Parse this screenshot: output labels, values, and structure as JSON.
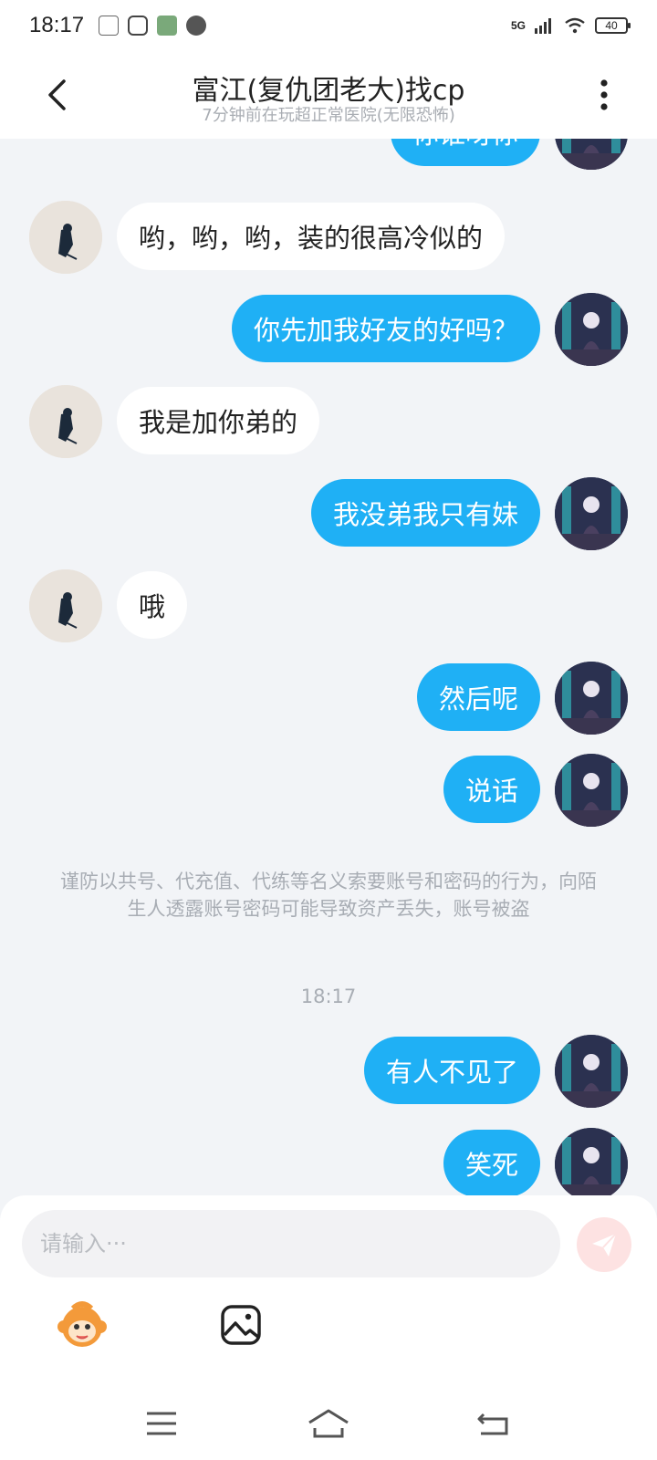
{
  "status_bar": {
    "time": "18:17",
    "network": "5G",
    "battery": "40"
  },
  "header": {
    "title": "富江(复仇团老大)找cp",
    "subtitle": "7分钟前在玩超正常医院(无限恐怖)"
  },
  "messages": [
    {
      "side": "out",
      "text": "你谁呀你"
    },
    {
      "side": "in",
      "text": "哟，哟，哟，装的很高冷似的"
    },
    {
      "side": "out",
      "text": "你先加我好友的好吗？"
    },
    {
      "side": "in",
      "text": "我是加你弟的"
    },
    {
      "side": "out",
      "text": "我没弟我只有妹"
    },
    {
      "side": "in",
      "text": "哦"
    },
    {
      "side": "out",
      "text": "然后呢"
    },
    {
      "side": "out",
      "text": "说话"
    },
    {
      "side": "out",
      "text": "有人不见了"
    },
    {
      "side": "out",
      "text": "笑死"
    }
  ],
  "notice": "谨防以共号、代充值、代练等名义索要账号和密码的行为，向陌生人透露账号密码可能导致资产丢失，账号被盗",
  "timestamp": "18:17",
  "input": {
    "placeholder": "请输入···"
  },
  "colors": {
    "accent": "#1fb0f5",
    "send_disabled": "#fde2e2"
  }
}
